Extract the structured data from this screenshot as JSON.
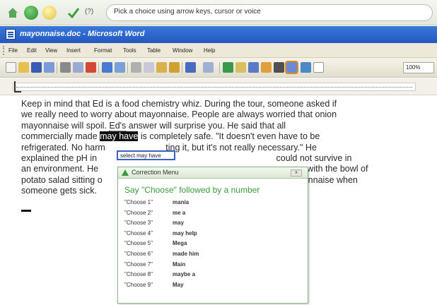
{
  "speech_bar": {
    "help_label": "(?)",
    "prompt": "Pick a choice using arrow keys, cursor or voice"
  },
  "window": {
    "title": "mayonnaise.doc - Microsoft Word"
  },
  "menu": [
    "File",
    "Edit",
    "View",
    "Insert",
    "Format",
    "Tools",
    "Table",
    "Window",
    "Help"
  ],
  "toolbar": {
    "zoom": "100%"
  },
  "document": {
    "line1": "Keep in mind that Ed is a food chemistry whiz. During the tour, someone asked if",
    "line2": "we really need to worry about mayonnaise. People are always worried that onion",
    "line3": "mayonnaise will spoil. ",
    "line3_hl": "Ed's",
    "line3_b": " answer will surprise you. He said that all",
    "line4_a": "commercially made ",
    "line4_hl": "may have",
    "line4_b": " is completely safe. \"It doesn't even have to be",
    "line5_a": "refrigerated. No harm ",
    "line5_b": "ting it, but it's not really necessary.\" He",
    "line6_a": "explained the pH in ",
    "line6_b": "could not survive in",
    "line7_a": "an environment. He",
    "line7_b": "c, with the bowl of",
    "line8_a": "potato salad sitting o",
    "line8_b": "e mayonnaise when",
    "line9": "someone gets sick."
  },
  "tooltip": "select may have",
  "correction_menu": {
    "title": "Correction Menu",
    "close_label": "x",
    "instruction": "Say \"Choose\" followed by a number",
    "items": [
      {
        "choose": "\"Choose 1\"",
        "suggestion": "mania"
      },
      {
        "choose": "\"Choose 2\"",
        "suggestion": "me a"
      },
      {
        "choose": "\"Choose 3\"",
        "suggestion": "may"
      },
      {
        "choose": "\"Choose 4\"",
        "suggestion": "may help"
      },
      {
        "choose": "\"Choose 5\"",
        "suggestion": "Mega"
      },
      {
        "choose": "\"Choose 6\"",
        "suggestion": "made him"
      },
      {
        "choose": "\"Choose 7\"",
        "suggestion": "Main"
      },
      {
        "choose": "\"Choose 8\"",
        "suggestion": "maybe a"
      },
      {
        "choose": "\"Choose 9\"",
        "suggestion": "May"
      }
    ]
  },
  "colors": {
    "title_bar": "#2458c0",
    "menu_bg": "#ece9d8",
    "instruction_text": "#3b9a3b",
    "highlight": "#111111",
    "toolbar_active": "#e08a20"
  }
}
